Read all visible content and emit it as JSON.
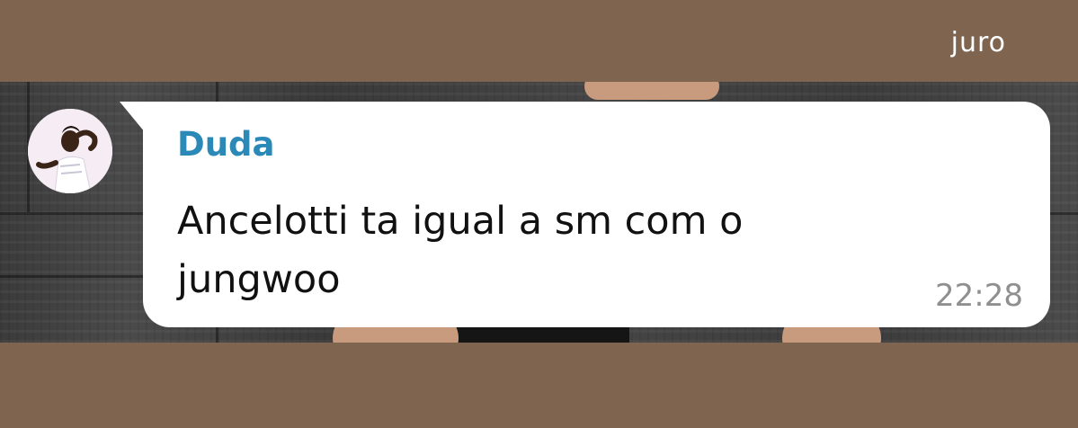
{
  "story": {
    "caption": "juro"
  },
  "message": {
    "sender": "Duda",
    "text": "Ancelotti ta igual a sm com o jungwoo",
    "time": "22:28",
    "sender_color": "#2b89b8"
  },
  "colors": {
    "background": "#7f6450",
    "bubble": "#ffffff",
    "text": "#111111",
    "time": "#8f8f8f"
  }
}
